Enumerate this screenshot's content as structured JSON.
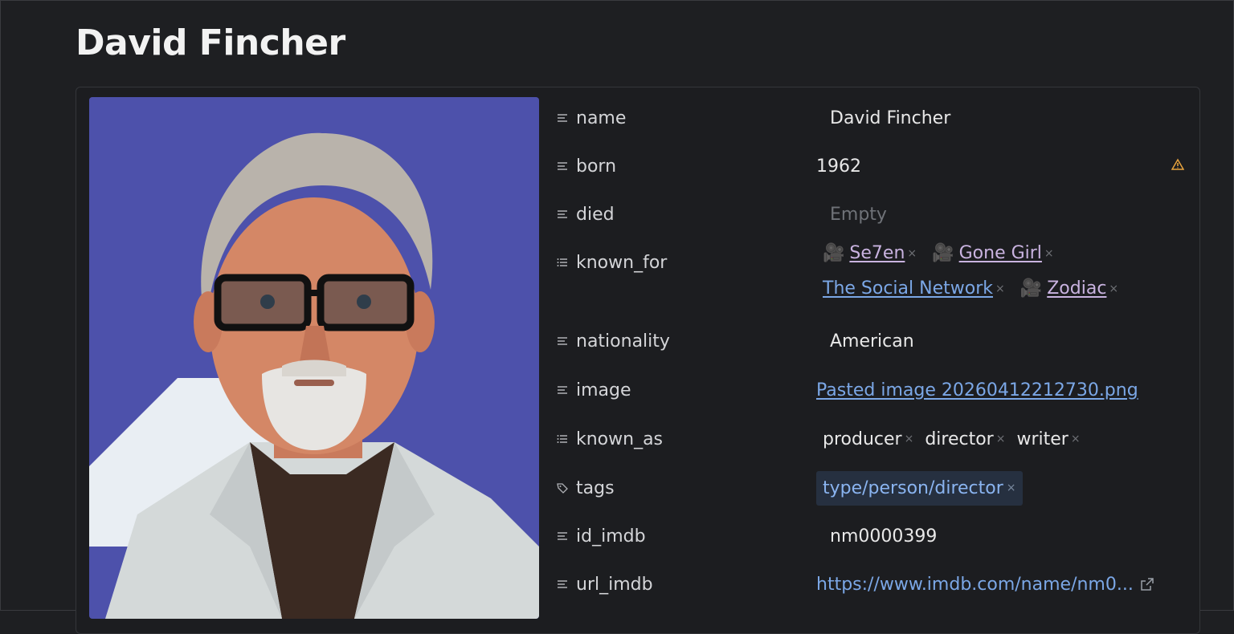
{
  "page": {
    "title": "David Fincher"
  },
  "properties": {
    "name": {
      "key": "name",
      "value": "David Fincher"
    },
    "born": {
      "key": "born",
      "value": "1962"
    },
    "died": {
      "key": "died",
      "placeholder": "Empty"
    },
    "known_for": {
      "key": "known_for",
      "items": [
        {
          "label": "Se7en",
          "icon": "movie-camera-icon"
        },
        {
          "label": "Gone Girl",
          "icon": "movie-camera-icon"
        },
        {
          "label": "The Social Network",
          "icon": ""
        },
        {
          "label": "Zodiac",
          "icon": "movie-camera-icon"
        }
      ]
    },
    "nationality": {
      "key": "nationality",
      "value": "American"
    },
    "image": {
      "key": "image",
      "value": "Pasted image 20260412212730.png"
    },
    "known_as": {
      "key": "known_as",
      "items": [
        "producer",
        "director",
        "writer"
      ]
    },
    "tags": {
      "key": "tags",
      "items": [
        "type/person/director"
      ]
    },
    "id_imdb": {
      "key": "id_imdb",
      "value": "nm0000399"
    },
    "url_imdb": {
      "key": "url_imdb",
      "value": "https://www.imdb.com/name/nm0..."
    }
  },
  "colors": {
    "background": "#1e1f22",
    "link": "#7ba7e6",
    "movie_link": "#c9b3e0",
    "tag_bg": "#263040",
    "warning": "#e8a33d"
  },
  "icons": {
    "text_property": "lines-icon",
    "list_property": "list-icon",
    "tags_property": "tag-icon",
    "warning": "warning-icon",
    "external": "external-link-icon"
  }
}
